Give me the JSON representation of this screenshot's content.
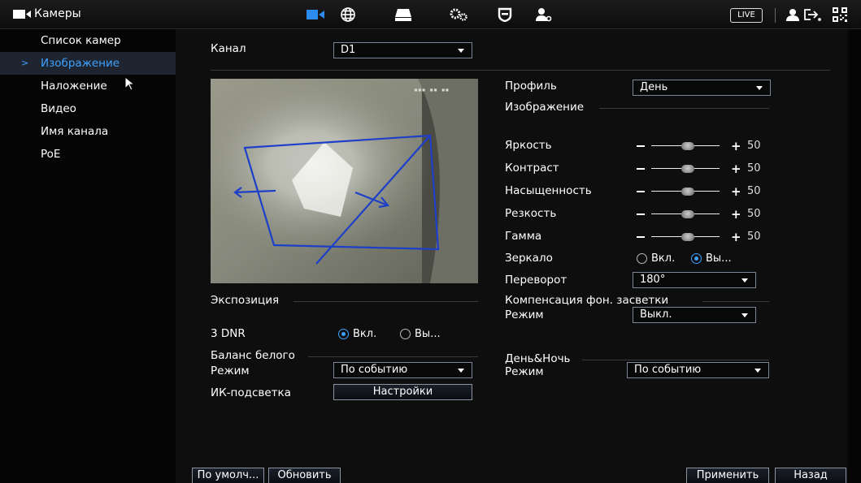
{
  "topbar": {
    "title": "Камеры",
    "icons": [
      "camera-icon",
      "network-icon",
      "storage-icon",
      "settings-icon",
      "security-icon",
      "account-icon"
    ],
    "live_label": "LIVE",
    "accent": "#3ea2ff"
  },
  "sidebar": {
    "items": [
      {
        "label": "Список камер"
      },
      {
        "label": "Изображение"
      },
      {
        "label": "Наложение"
      },
      {
        "label": "Видео"
      },
      {
        "label": "Имя канала"
      },
      {
        "label": "PoE"
      }
    ],
    "active_index": 1
  },
  "channel": {
    "label": "Канал",
    "value": "D1"
  },
  "profile": {
    "label": "Профиль",
    "value": "День"
  },
  "image_section": {
    "title": "Изображение"
  },
  "sliders": [
    {
      "label": "Яркость",
      "value": 50
    },
    {
      "label": "Контраст",
      "value": 50
    },
    {
      "label": "Насыщенность",
      "value": 50
    },
    {
      "label": "Резкость",
      "value": 50
    },
    {
      "label": "Гамма",
      "value": 50
    }
  ],
  "mirror": {
    "label": "Зеркало",
    "on_label": "Вкл.",
    "off_label": "Вы...",
    "selected": "off"
  },
  "flip": {
    "label": "Переворот",
    "value": "180°"
  },
  "backlight": {
    "title": "Компенсация фон. засветки",
    "mode_label": "Режим",
    "mode_value": "Выкл."
  },
  "exposure": {
    "title": "Экспозиция"
  },
  "dnr": {
    "label": "3 DNR",
    "on_label": "Вкл.",
    "off_label": "Вы...",
    "selected": "on"
  },
  "white_balance": {
    "title": "Баланс белого",
    "mode_label": "Режим",
    "mode_value": "По событию"
  },
  "day_night": {
    "title": "День&Ночь",
    "mode_label": "Режим",
    "mode_value": "По событию"
  },
  "ir": {
    "label": "ИК-подсветка",
    "button_label": "Настройки"
  },
  "footer": {
    "default_label": "По умолч...",
    "refresh_label": "Обновить",
    "apply_label": "Применить",
    "back_label": "Назад"
  }
}
